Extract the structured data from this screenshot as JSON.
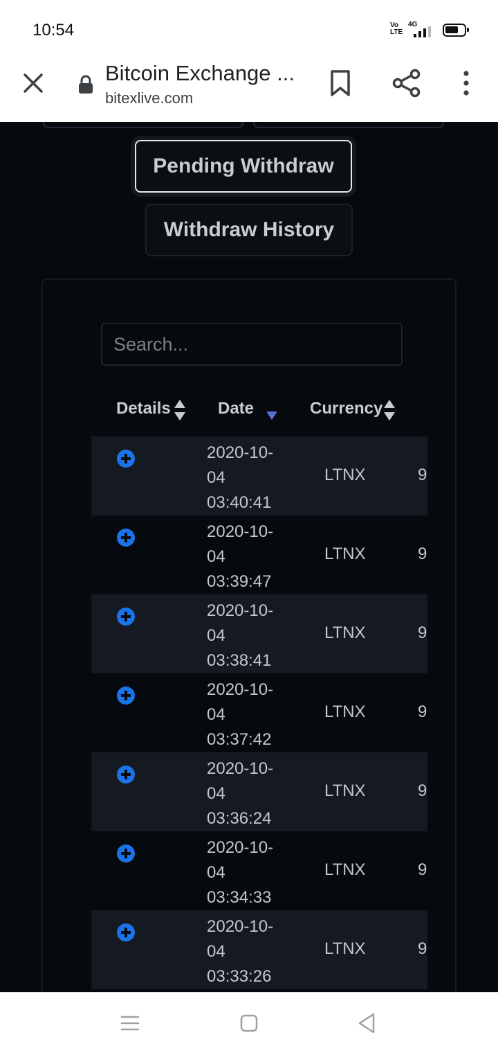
{
  "status_bar": {
    "time": "10:54",
    "volte": "Vo\nLTE",
    "network": "4G"
  },
  "browser": {
    "title": "Bitcoin Exchange ...",
    "url": "bitexlive.com"
  },
  "tabs": {
    "pending": "Pending Withdraw",
    "history": "Withdraw History"
  },
  "search": {
    "placeholder": "Search..."
  },
  "table": {
    "headers": {
      "details": "Details",
      "date": "Date",
      "currency": "Currency"
    },
    "rows": [
      {
        "date": "2020-10-04 03:40:41",
        "currency": "LTNX",
        "amount": "9"
      },
      {
        "date": "2020-10-04 03:39:47",
        "currency": "LTNX",
        "amount": "9"
      },
      {
        "date": "2020-10-04 03:38:41",
        "currency": "LTNX",
        "amount": "9"
      },
      {
        "date": "2020-10-04 03:37:42",
        "currency": "LTNX",
        "amount": "9"
      },
      {
        "date": "2020-10-04 03:36:24",
        "currency": "LTNX",
        "amount": "9"
      },
      {
        "date": "2020-10-04 03:34:33",
        "currency": "LTNX",
        "amount": "9"
      },
      {
        "date": "2020-10-04 03:33:26",
        "currency": "LTNX",
        "amount": "9"
      }
    ]
  },
  "colors": {
    "background": "#06090d",
    "row_stripe": "#151a22",
    "accent_blue": "#1a73e8",
    "sort_active": "#5b6fd8"
  }
}
